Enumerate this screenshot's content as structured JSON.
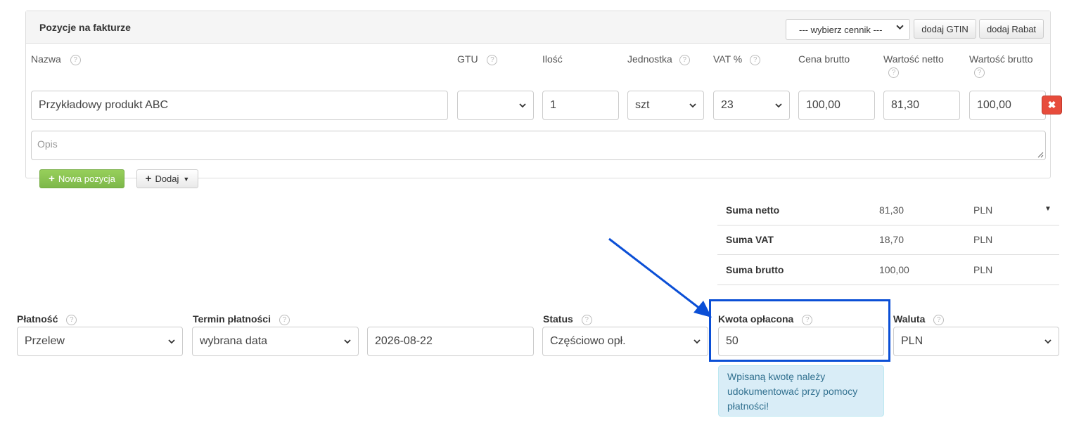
{
  "panel": {
    "title": "Pozycje na fakturze",
    "pricelist_select": "--- wybierz cennik ---",
    "gtin_button": "dodaj GTIN",
    "rabat_button": "dodaj Rabat"
  },
  "columns": {
    "nazwa": "Nazwa",
    "gtu": "GTU",
    "ilosc": "Ilość",
    "jednostka": "Jednostka",
    "vat": "VAT %",
    "cena_brutto": "Cena brutto",
    "wartosc_netto": "Wartość netto",
    "wartosc_brutto": "Wartość brutto"
  },
  "item": {
    "nazwa": "Przykładowy produkt ABC",
    "gtu": "",
    "ilosc": "1",
    "jednostka": "szt",
    "vat": "23",
    "cena_brutto": "100,00",
    "wartosc_netto": "81,30",
    "wartosc_brutto": "100,00",
    "opis_placeholder": "Opis",
    "delete_label": "✖"
  },
  "actions": {
    "new_position": "Nowa pozycja",
    "add": "Dodaj"
  },
  "summary": {
    "rows": [
      {
        "label": "Suma netto",
        "value": "81,30",
        "currency": "PLN"
      },
      {
        "label": "Suma VAT",
        "value": "18,70",
        "currency": "PLN"
      },
      {
        "label": "Suma brutto",
        "value": "100,00",
        "currency": "PLN"
      }
    ]
  },
  "payment": {
    "platnosc_label": "Płatność",
    "platnosc_value": "Przelew",
    "termin_label": "Termin płatności",
    "termin_value": "wybrana data",
    "date_value": "2026-08-22",
    "status_label": "Status",
    "status_value": "Częściowo opł.",
    "kwota_label": "Kwota opłacona",
    "kwota_value": "50",
    "waluta_label": "Waluta",
    "waluta_value": "PLN",
    "alert": "Wpisaną kwotę należy udokumentować przy pomocy płatności!"
  },
  "colors": {
    "highlight": "#0b4fd6",
    "delete": "#e74c3c",
    "green": "#8cc152",
    "alert_bg": "#d9edf7"
  }
}
